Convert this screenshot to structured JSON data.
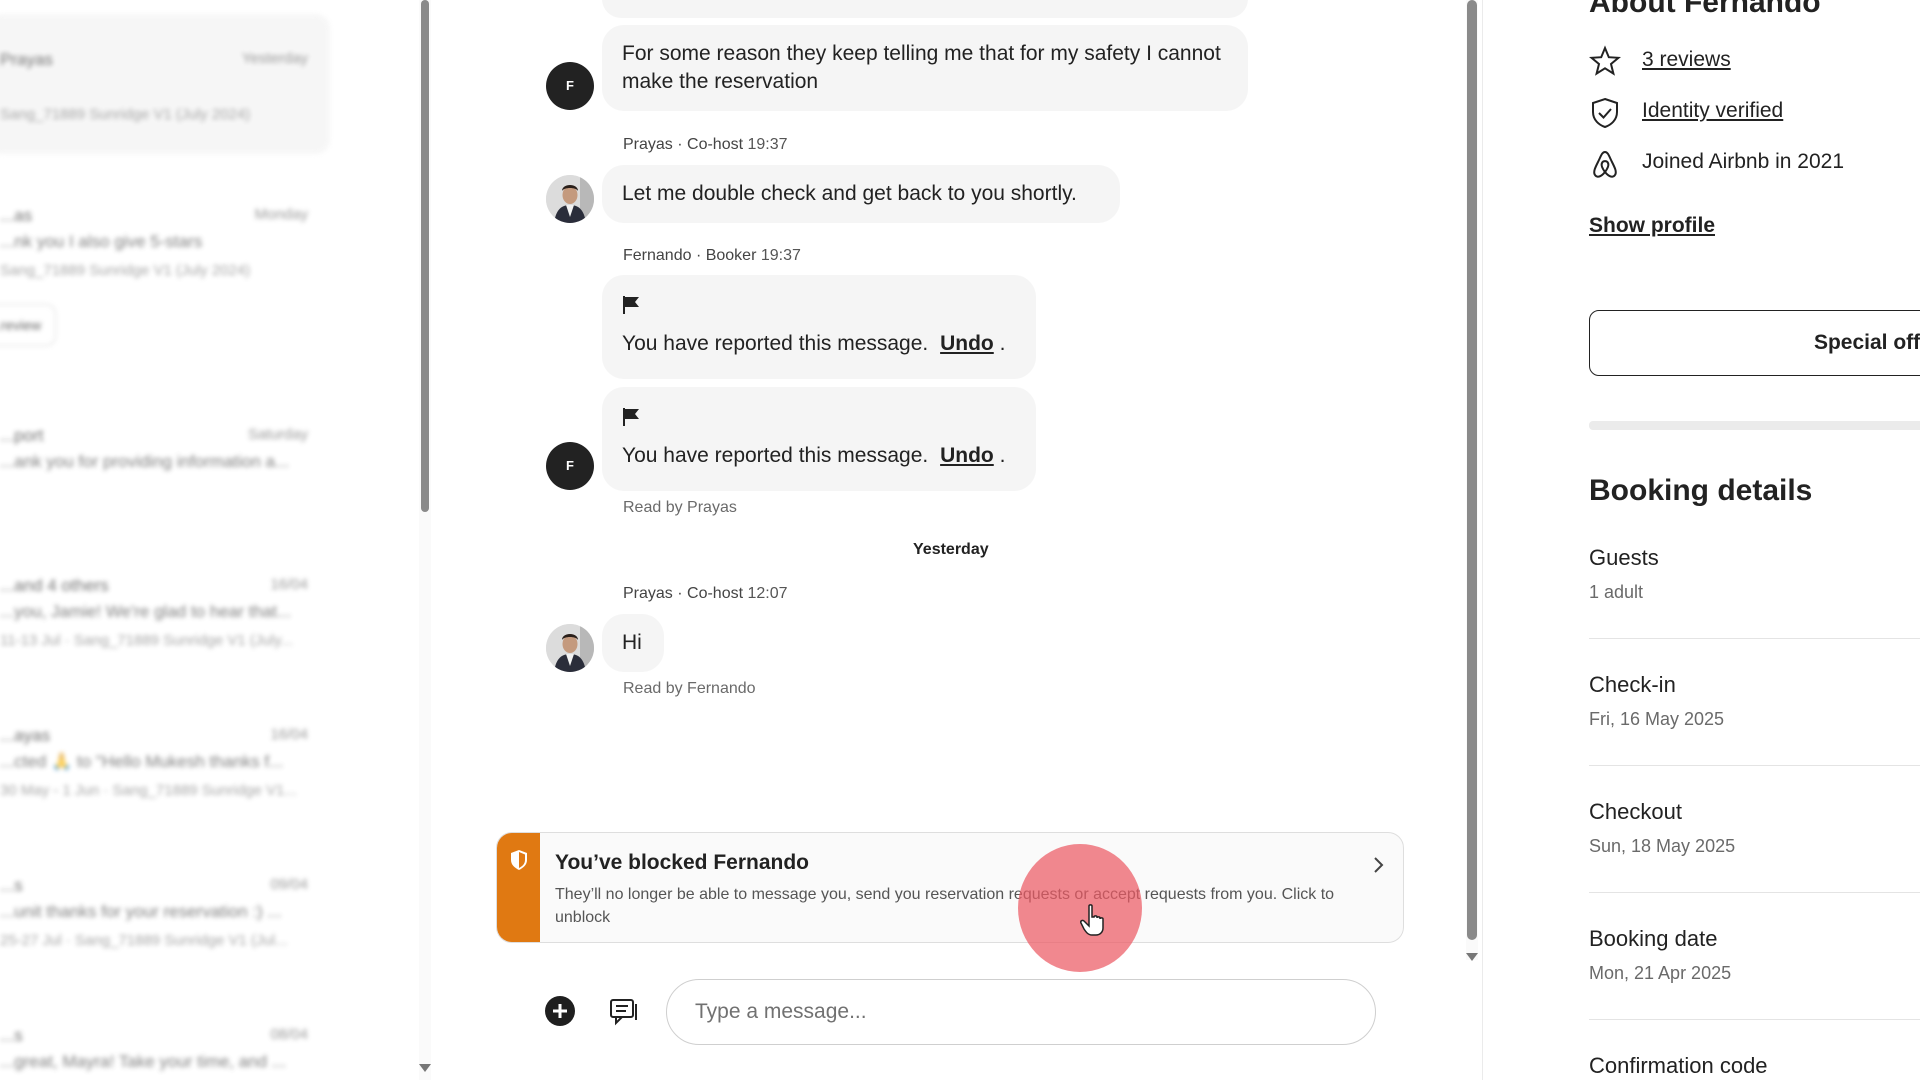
{
  "conversation_list": {
    "items": [
      {
        "name": "Prayas",
        "date": "Yesterday",
        "message": "",
        "sub": "Sang_71889 Sunridge V1 (July 2024)"
      },
      {
        "name": "...as",
        "date": "Monday",
        "message": "...nk you I also give 5-stars",
        "sub": "Sang_71889 Sunridge V1 (July 2024)",
        "button": "...review"
      },
      {
        "name": "...port",
        "date": "Saturday",
        "message": "...ank you for providing information a...",
        "sub": ""
      },
      {
        "name": "...and 4 others",
        "date": "16/04",
        "message": "...you, Jamie! We're glad to hear that...",
        "sub": "11-13 Jul · Sang_71889 Sunridge V1 (July..."
      },
      {
        "name": "...ayas",
        "date": "16/04",
        "message": "...cted 🙏 to \"Hello Mukesh thanks f...",
        "sub": "30 May - 1 Jun · Sang_71889 Sunridge V1..."
      },
      {
        "name": "...s",
        "date": "09/04",
        "message": "...unit thanks for your reservation :) ...",
        "sub": "25-27 Jul · Sang_71889 Sunridge V1 (Jul..."
      },
      {
        "name": "...s",
        "date": "08/04",
        "message": "...great, Mayra! Take your time, and ...",
        "sub": ""
      }
    ]
  },
  "chat": {
    "messages": [
      {
        "avatar": "F",
        "text": "For some reason they keep telling me that for my safety I cannot make the reservation"
      },
      {
        "sender": "Prayas · Co-host",
        "time": "19:37",
        "text": "Let me double check and get back to you shortly."
      },
      {
        "sender": "Fernando · Booker",
        "time": "19:37",
        "reported_text": "You have reported this message.",
        "undo": "Undo",
        "period": "."
      },
      {
        "avatar": "F",
        "reported_text": "You have reported this message.",
        "undo": "Undo",
        "period": ".",
        "read": "Read by Prayas"
      },
      {
        "sender": "Prayas · Co-host",
        "time": "12:07",
        "text": "Hi",
        "read": "Read by Fernando"
      }
    ],
    "day_separator": "Yesterday",
    "blocked_banner": {
      "title": "You’ve blocked Fernando",
      "text": "They’ll no longer be able to message you, send you reservation requests or accept requests from you. Click to unblock"
    },
    "composer": {
      "placeholder": "Type a message..."
    }
  },
  "details": {
    "about_title": "About Fernando",
    "reviews": "3 reviews",
    "identity": "Identity verified",
    "joined": "Joined Airbnb in 2021",
    "show_profile": "Show profile",
    "special_offer": "Special offer",
    "booking_title": "Booking details",
    "fields": [
      {
        "label": "Guests",
        "value": "1 adult"
      },
      {
        "label": "Check-in",
        "value": "Fri, 16 May 2025"
      },
      {
        "label": "Checkout",
        "value": "Sun, 18 May 2025"
      },
      {
        "label": "Booking date",
        "value": "Mon, 21 Apr 2025"
      },
      {
        "label": "Confirmation code",
        "value": ""
      }
    ]
  },
  "colors": {
    "accent_blocked": "#e07912",
    "click_indicator": "#ec5a64",
    "avatar_dark": "#222222"
  }
}
